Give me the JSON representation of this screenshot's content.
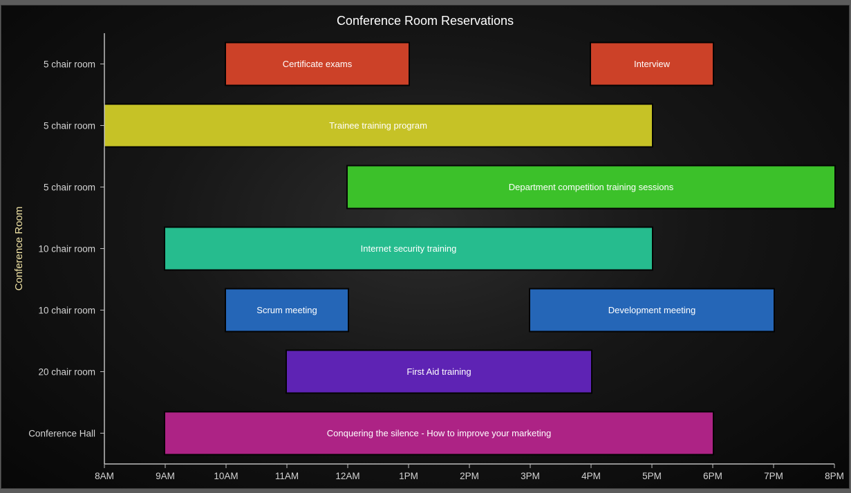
{
  "chart_data": {
    "type": "bar",
    "orientation": "horizontal-gantt",
    "title": "Conference Room Reservations",
    "xlabel": "",
    "ylabel": "Conference Room",
    "x_ticks": [
      "8AM",
      "9AM",
      "10AM",
      "11AM",
      "12AM",
      "1PM",
      "2PM",
      "3PM",
      "4PM",
      "5PM",
      "6PM",
      "7PM",
      "8PM"
    ],
    "xlim": [
      8,
      20
    ],
    "categories": [
      "5 chair room",
      "5 chair room",
      "5 chair room",
      "10 chair room",
      "10 chair room",
      "20 chair room",
      "Conference Hall"
    ],
    "grid": false,
    "tasks": [
      {
        "row": 0,
        "start": 10,
        "end": 13,
        "label": "Certificate exams",
        "color": "#cc4128"
      },
      {
        "row": 0,
        "start": 16,
        "end": 18,
        "label": "Interview",
        "color": "#cc4128"
      },
      {
        "row": 1,
        "start": 8,
        "end": 17,
        "label": "Trainee training program",
        "color": "#c6c226"
      },
      {
        "row": 2,
        "start": 12,
        "end": 20,
        "label": "Department competition training sessions",
        "color": "#3cc12a"
      },
      {
        "row": 3,
        "start": 9,
        "end": 17,
        "label": "Internet security training",
        "color": "#26bc8e"
      },
      {
        "row": 4,
        "start": 10,
        "end": 12,
        "label": "Scrum meeting",
        "color": "#2566b7"
      },
      {
        "row": 4,
        "start": 15,
        "end": 19,
        "label": "Development meeting",
        "color": "#2566b7"
      },
      {
        "row": 5,
        "start": 11,
        "end": 16,
        "label": "First Aid training",
        "color": "#5e23b4"
      },
      {
        "row": 6,
        "start": 9,
        "end": 18,
        "label": "Conquering the silence - How to improve your marketing",
        "color": "#ad2385"
      }
    ]
  }
}
